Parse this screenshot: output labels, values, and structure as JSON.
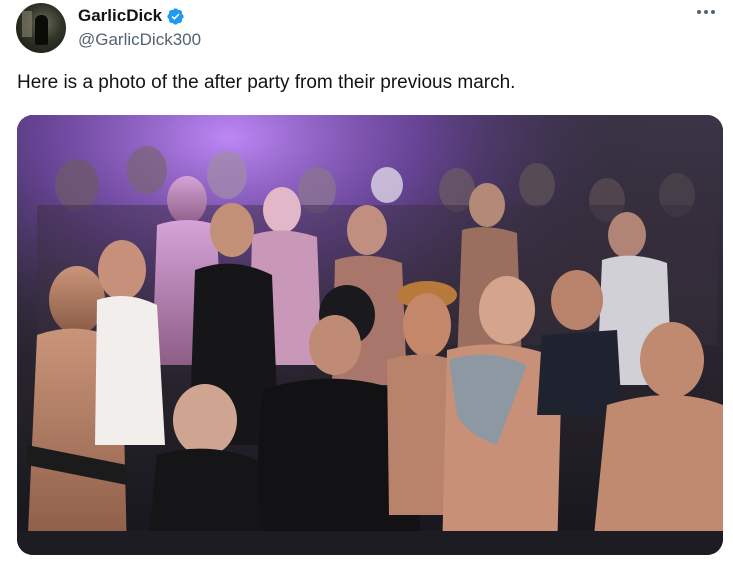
{
  "author": {
    "display_name": "GarlicDick",
    "handle": "@GarlicDick300",
    "avatar_icon": "profile-photo",
    "verified_icon": "verified-badge-icon",
    "verified_color": "#1d9bf0"
  },
  "menu": {
    "more_icon": "more-options-icon"
  },
  "tweet": {
    "text": "Here is a photo of the after party from their previous march."
  },
  "media": {
    "type": "photo",
    "colors": {
      "background": "#22222c",
      "purple_light": "#b06cff",
      "bottom_bar": "#1c1c22"
    }
  }
}
